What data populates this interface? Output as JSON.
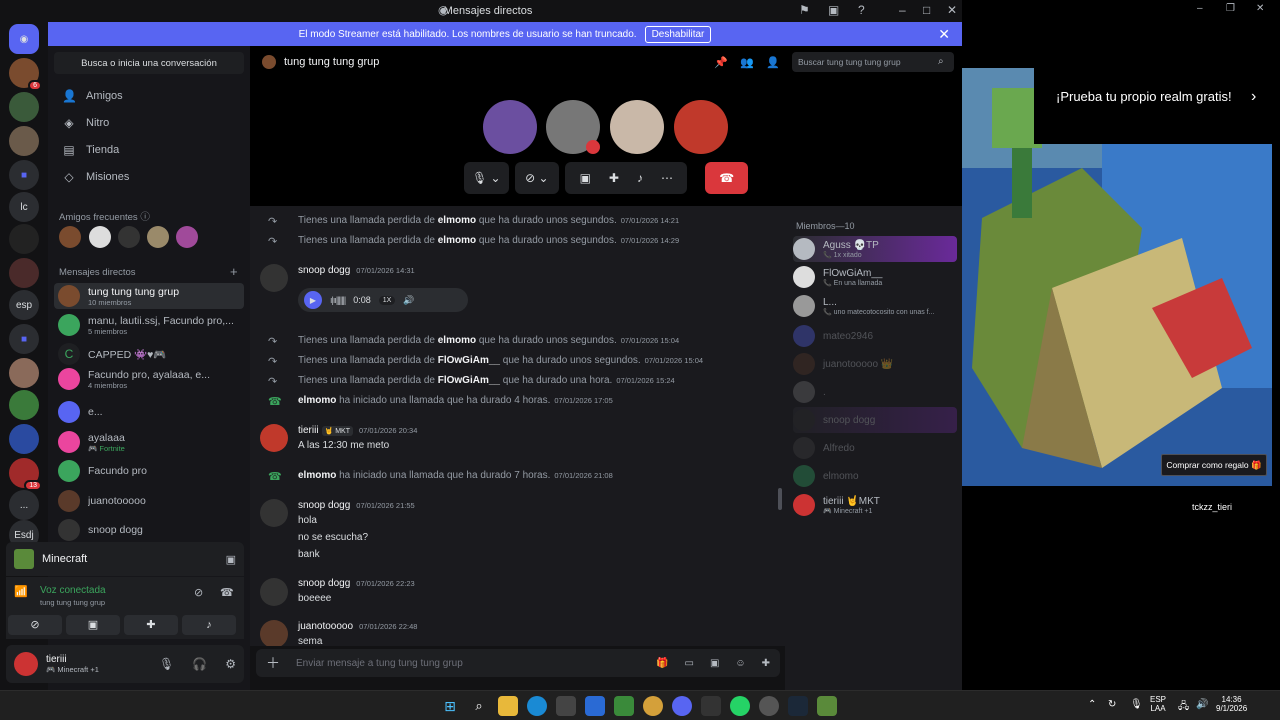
{
  "window": {
    "title": "Mensajes directos"
  },
  "banner": {
    "text": "El modo Streamer está habilitado. Los nombres de usuario se han truncado.",
    "button": "Deshabilitar"
  },
  "rail": [
    "esp",
    "lc",
    "Esdj",
    "..."
  ],
  "rail_badges": [
    "6",
    "13"
  ],
  "sidebar": {
    "search": "Busca o inicia una conversación",
    "nav": [
      {
        "label": "Amigos",
        "icon": "friends-icon"
      },
      {
        "label": "Nitro",
        "icon": "nitro-icon"
      },
      {
        "label": "Tienda",
        "icon": "shop-icon"
      },
      {
        "label": "Misiones",
        "icon": "quests-icon"
      }
    ],
    "frequent_label": "Amigos frecuentes",
    "dm_label": "Mensajes directos",
    "dms": [
      {
        "name": "tung tung tung grup",
        "sub": "10 miembros",
        "color": "#7a4b2e"
      },
      {
        "name": "manu, lautii.ssj, Facundo pro,...",
        "sub": "5 miembros",
        "color": "#3ba55d"
      },
      {
        "name": "CAPPED 👾♥🎮",
        "sub": "",
        "color": "#1e1f22"
      },
      {
        "name": "Facundo pro, ayalaaa, e...",
        "sub": "4 miembros",
        "color": "#eb459e"
      },
      {
        "name": "e...",
        "sub": "",
        "color": "#5865f2"
      },
      {
        "name": "ayalaaa",
        "sub": "🎮 Fortnite",
        "color": "#eb459e"
      },
      {
        "name": "Facundo pro",
        "sub": "",
        "color": "#3ba55d"
      },
      {
        "name": "juanotooooo",
        "sub": "",
        "color": "#5a3a2a"
      },
      {
        "name": "snoop dogg",
        "sub": "",
        "color": "#333"
      }
    ]
  },
  "game": {
    "name": "Minecraft"
  },
  "voice": {
    "status": "Voz conectada",
    "channel": "tung tung tung grup"
  },
  "user": {
    "name": "tieriii",
    "status": "🎮 Minecraft +1"
  },
  "chat": {
    "title": "tung tung tung grup",
    "search_placeholder": "Buscar tung tung tung grup",
    "composer_placeholder": "Enviar mensaje a tung tung tung grup",
    "voice_msg": {
      "duration": "0:08",
      "speed": "1X"
    },
    "sys1": {
      "pre": "Tienes una llamada perdida de ",
      "who": "elmomo",
      "post": " que ha durado unos segundos.",
      "ts": "07/01/2026 14:21"
    },
    "sys2": {
      "pre": "Tienes una llamada perdida de ",
      "who": "elmomo",
      "post": " que ha durado unos segundos.",
      "ts": "07/01/2026 14:29"
    },
    "msg1": {
      "author": "snoop dogg",
      "ts": "07/01/2026 14:31"
    },
    "sys3": {
      "pre": "Tienes una llamada perdida de ",
      "who": "elmomo",
      "post": " que ha durado unos segundos.",
      "ts": "07/01/2026 15:04"
    },
    "sys4": {
      "pre": "Tienes una llamada perdida de ",
      "who": "FlOwGiAm__",
      "post": " que ha durado unos segundos.",
      "ts": "07/01/2026 15:04"
    },
    "sys5": {
      "pre": "Tienes una llamada perdida de ",
      "who": "FlOwGiAm__",
      "post": " que ha durado una hora.",
      "ts": "07/01/2026 15:24"
    },
    "sys6": {
      "who": "elmomo",
      "post": " ha iniciado una llamada que ha durado 4 horas.",
      "ts": "07/01/2026 17:05"
    },
    "msg2": {
      "author": "tieriii",
      "tag": "🤘 MKT",
      "ts": "07/01/2026 20:34",
      "text": "A las 12:30 me meto"
    },
    "sys7": {
      "who": "elmomo",
      "post": " ha iniciado una llamada que ha durado 7 horas.",
      "ts": "07/01/2026 21:08"
    },
    "msg3": {
      "author": "snoop dogg",
      "ts": "07/01/2026 21:55",
      "lines": [
        "hola",
        "no se escucha?",
        "bank"
      ]
    },
    "msg4": {
      "author": "snoop dogg",
      "ts": "07/01/2026 22:23",
      "text": "boeeee"
    },
    "msg5": {
      "author": "juanotooooo",
      "ts": "07/01/2026 22:48",
      "text": "sema"
    }
  },
  "members": {
    "header": "Miembros—10",
    "list": [
      {
        "name": "Aguss 💀TP",
        "status": "📞 1x xitado",
        "color": "#b5bac1"
      },
      {
        "name": "FlOwGiAm__",
        "status": "📞 En una llamada",
        "color": "#ddd"
      },
      {
        "name": "L...",
        "status": "📞 uno matecotocosito con unas f...",
        "color": "#999"
      },
      {
        "name": "mateo2946",
        "status": "",
        "color": "#5865f2"
      },
      {
        "name": "juanotooooo 👑",
        "status": "",
        "color": "#5a3a2a"
      },
      {
        "name": ".",
        "status": "",
        "color": "#777"
      },
      {
        "name": "snoop dogg",
        "status": "",
        "color": "#333"
      },
      {
        "name": "Alfredo",
        "status": "",
        "color": "#444"
      },
      {
        "name": "elmomo",
        "status": "",
        "color": "#3a6"
      },
      {
        "name": "tieriii 🤘MKT",
        "status": "🎮 Minecraft +1",
        "color": "#c33"
      }
    ]
  },
  "ad": {
    "title": "¡Prueba tu propio realm gratis!",
    "button": "Comprar como regalo 🎁",
    "username": "tckzz_tieri"
  },
  "taskbar": {
    "lang": "ESP",
    "lang2": "LAA",
    "time": "14:36",
    "date": "9/1/2026"
  }
}
